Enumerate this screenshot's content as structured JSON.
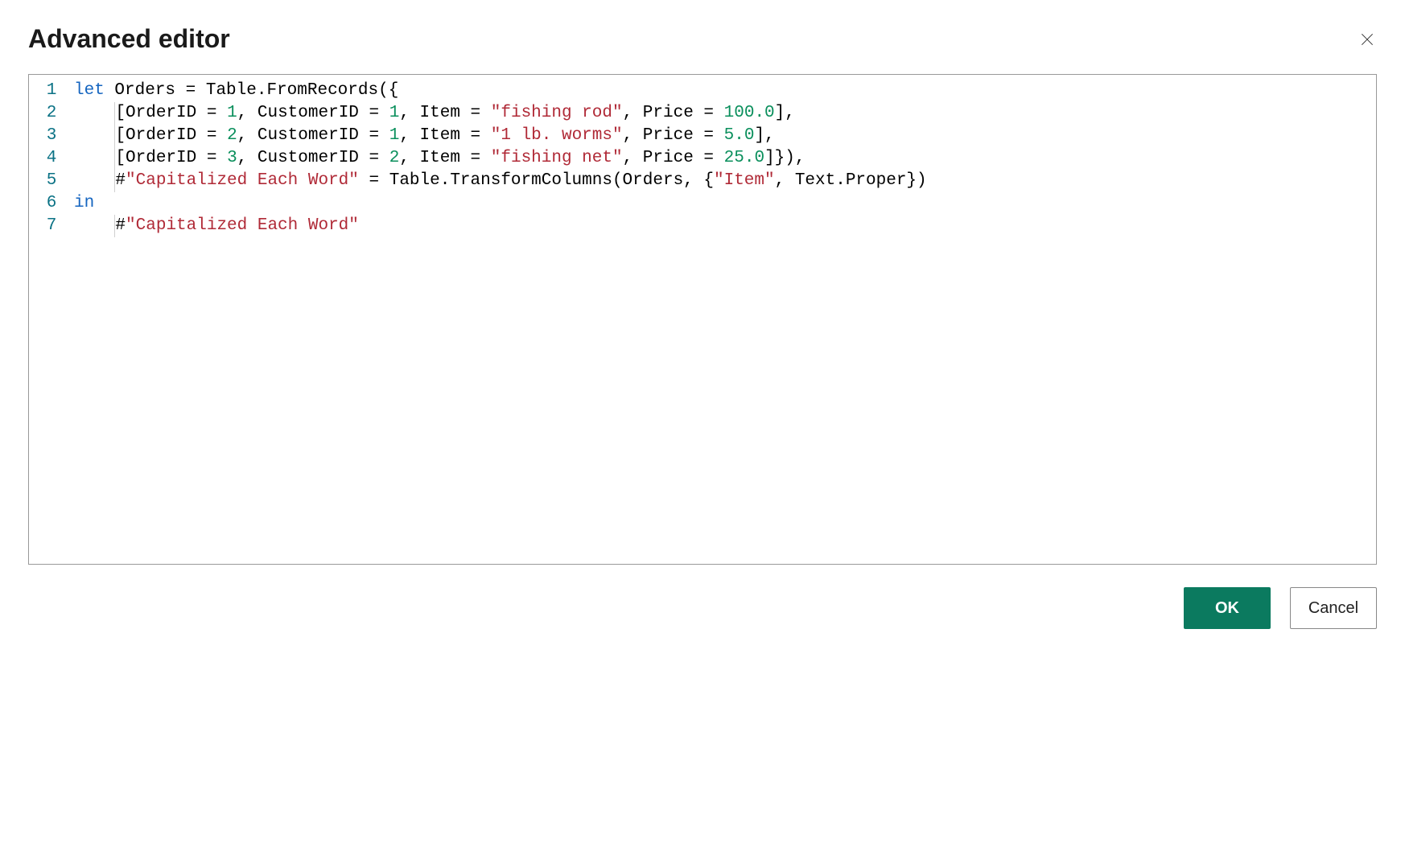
{
  "header": {
    "title": "Advanced editor"
  },
  "buttons": {
    "ok": "OK",
    "cancel": "Cancel"
  },
  "editor": {
    "lines": [
      {
        "num": "1",
        "indent": "",
        "tokens": [
          {
            "cls": "kw",
            "t": "let"
          },
          {
            "cls": "id",
            "t": " Orders "
          },
          {
            "cls": "op",
            "t": "="
          },
          {
            "cls": "id",
            "t": " Table.FromRecords({"
          }
        ]
      },
      {
        "num": "2",
        "indent": "    ",
        "tokens": [
          {
            "cls": "id",
            "t": "[OrderID "
          },
          {
            "cls": "op",
            "t": "="
          },
          {
            "cls": "id",
            "t": " "
          },
          {
            "cls": "num",
            "t": "1"
          },
          {
            "cls": "id",
            "t": ", CustomerID "
          },
          {
            "cls": "op",
            "t": "="
          },
          {
            "cls": "id",
            "t": " "
          },
          {
            "cls": "num",
            "t": "1"
          },
          {
            "cls": "id",
            "t": ", Item "
          },
          {
            "cls": "op",
            "t": "="
          },
          {
            "cls": "id",
            "t": " "
          },
          {
            "cls": "str",
            "t": "\"fishing rod\""
          },
          {
            "cls": "id",
            "t": ", Price "
          },
          {
            "cls": "op",
            "t": "="
          },
          {
            "cls": "id",
            "t": " "
          },
          {
            "cls": "num",
            "t": "100.0"
          },
          {
            "cls": "id",
            "t": "],"
          }
        ]
      },
      {
        "num": "3",
        "indent": "    ",
        "tokens": [
          {
            "cls": "id",
            "t": "[OrderID "
          },
          {
            "cls": "op",
            "t": "="
          },
          {
            "cls": "id",
            "t": " "
          },
          {
            "cls": "num",
            "t": "2"
          },
          {
            "cls": "id",
            "t": ", CustomerID "
          },
          {
            "cls": "op",
            "t": "="
          },
          {
            "cls": "id",
            "t": " "
          },
          {
            "cls": "num",
            "t": "1"
          },
          {
            "cls": "id",
            "t": ", Item "
          },
          {
            "cls": "op",
            "t": "="
          },
          {
            "cls": "id",
            "t": " "
          },
          {
            "cls": "str",
            "t": "\"1 lb. worms\""
          },
          {
            "cls": "id",
            "t": ", Price "
          },
          {
            "cls": "op",
            "t": "="
          },
          {
            "cls": "id",
            "t": " "
          },
          {
            "cls": "num",
            "t": "5.0"
          },
          {
            "cls": "id",
            "t": "],"
          }
        ]
      },
      {
        "num": "4",
        "indent": "    ",
        "tokens": [
          {
            "cls": "id",
            "t": "[OrderID "
          },
          {
            "cls": "op",
            "t": "="
          },
          {
            "cls": "id",
            "t": " "
          },
          {
            "cls": "num",
            "t": "3"
          },
          {
            "cls": "id",
            "t": ", CustomerID "
          },
          {
            "cls": "op",
            "t": "="
          },
          {
            "cls": "id",
            "t": " "
          },
          {
            "cls": "num",
            "t": "2"
          },
          {
            "cls": "id",
            "t": ", Item "
          },
          {
            "cls": "op",
            "t": "="
          },
          {
            "cls": "id",
            "t": " "
          },
          {
            "cls": "str",
            "t": "\"fishing net\""
          },
          {
            "cls": "id",
            "t": ", Price "
          },
          {
            "cls": "op",
            "t": "="
          },
          {
            "cls": "id",
            "t": " "
          },
          {
            "cls": "num",
            "t": "25.0"
          },
          {
            "cls": "id",
            "t": "]}),"
          }
        ]
      },
      {
        "num": "5",
        "indent": "    ",
        "tokens": [
          {
            "cls": "id",
            "t": "#"
          },
          {
            "cls": "str",
            "t": "\"Capitalized Each Word\""
          },
          {
            "cls": "id",
            "t": " "
          },
          {
            "cls": "op",
            "t": "="
          },
          {
            "cls": "id",
            "t": " Table.TransformColumns(Orders, {"
          },
          {
            "cls": "str",
            "t": "\"Item\""
          },
          {
            "cls": "id",
            "t": ", Text.Proper})"
          }
        ]
      },
      {
        "num": "6",
        "indent": "",
        "tokens": [
          {
            "cls": "kw",
            "t": "in"
          }
        ]
      },
      {
        "num": "7",
        "indent": "    ",
        "tokens": [
          {
            "cls": "id",
            "t": "#"
          },
          {
            "cls": "str",
            "t": "\"Capitalized Each Word\""
          }
        ]
      }
    ]
  }
}
